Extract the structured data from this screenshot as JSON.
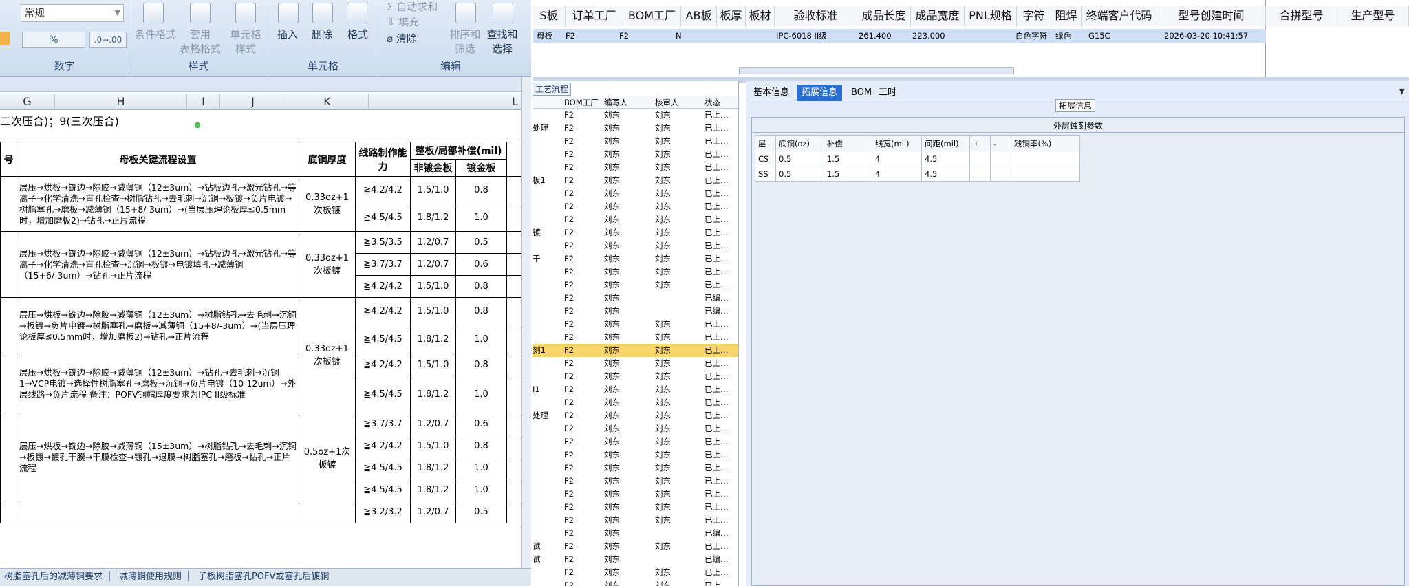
{
  "ribbon": {
    "number_format": "常规",
    "autosum": "自动求和",
    "fill": "填充",
    "clear": "清除",
    "cond_format": "条件格式",
    "table_format_1": "套用",
    "table_format_2": "表格格式",
    "cell_style_1": "单元格",
    "cell_style_2": "样式",
    "insert": "插入",
    "delete": "删除",
    "format": "格式",
    "sort_1": "排序和",
    "sort_2": "筛选",
    "find_1": "查找和",
    "find_2": "选择",
    "group_number": "数字",
    "group_style": "样式",
    "group_cells": "单元格",
    "group_edit": "编辑",
    "percent": "%"
  },
  "sheet": {
    "columns": [
      "G",
      "H",
      "I",
      "J",
      "K",
      "L"
    ],
    "top_note": "二次压合)；9(三次压合)",
    "headers": {
      "h_key": "母板关键流程设置",
      "h_cu": "底铜厚度",
      "h_cap": "线路制作能力",
      "h_comp": "整板/局部补偿(mil)",
      "h_nonplate": "非镀金板",
      "h_plate": "镀金板",
      "h_prefix": "号"
    },
    "blocks": [
      {
        "process": "层压→烘板→铣边→除胶→减薄铜（12±3um）→钻板边孔→激光钻孔→等离子→化学清洗→盲孔检查→树脂钻孔→去毛刺→沉铜→板镀→负片电镀→树脂塞孔→磨板→减薄铜（15+8/-3um）→(当层压理论板厚≦0.5mm时，增加磨板2)→钻孔→正片流程",
        "cu": "0.33oz+1次板镀",
        "rows": [
          [
            "≧4.2/4.2",
            "1.5/1.0",
            "0.8"
          ],
          [
            "≧4.5/4.5",
            "1.8/1.2",
            "1.0"
          ]
        ]
      },
      {
        "process": "层压→烘板→铣边→除胶→减薄铜（12±3um）→钻板边孔→激光钻孔→等离子→化学清洗→盲孔检查→沉铜→板镀→电镀填孔→减薄铜（15+6/-3um）→钻孔→正片流程",
        "cu": "0.33oz+1次板镀",
        "rows": [
          [
            "≧3.5/3.5",
            "1.2/0.7",
            "0.5"
          ],
          [
            "≧3.7/3.7",
            "1.2/0.7",
            "0.6"
          ],
          [
            "≧4.2/4.2",
            "1.5/1.0",
            "0.8"
          ]
        ]
      },
      {
        "process": "层压→烘板→铣边→除胶→减薄铜（12±3um）→树脂钻孔→去毛刺→沉铜→板镀→负片电镀→树脂塞孔→磨板→减薄铜（15+8/-3um）→(当层压理论板厚≦0.5mm时，增加磨板2)→钻孔→正片流程",
        "cu": "0.33oz+1次板镀",
        "rows": [
          [
            "≧4.2/4.2",
            "1.5/1.0",
            "0.8"
          ],
          [
            "≧4.5/4.5",
            "1.8/1.2",
            "1.0"
          ],
          [
            "≧4.2/4.2",
            "1.5/1.0",
            "0.8"
          ]
        ]
      },
      {
        "process": "层压→烘板→铣边→除胶→减薄铜（12±3um）→钻孔→去毛刺→沉铜1→VCP电镀→选择性树脂塞孔→磨板→沉铜→负片电镀（10-12um）→外层线路→负片流程 备注：POFV铜帽厚度要求为IPC II级标准",
        "rows": [
          [
            "≧4.5/4.5",
            "1.8/1.2",
            "1.0"
          ]
        ]
      },
      {
        "process": "层压→烘板→铣边→除胶→减薄铜（15±3um）→树脂钻孔→去毛刺→沉铜→板镀→镀孔干膜→干膜检查→镀孔→退膜→树脂塞孔→磨板→钻孔→正片流程",
        "cu": "0.5oz+1次板镀",
        "rows": [
          [
            "≧3.7/3.7",
            "1.2/0.7",
            "0.6"
          ],
          [
            "≧4.2/4.2",
            "1.5/1.0",
            "0.8"
          ],
          [
            "≧4.5/4.5",
            "1.8/1.2",
            "1.0"
          ],
          [
            "≧4.5/4.5",
            "1.8/1.2",
            "1.0"
          ]
        ]
      },
      {
        "process": "",
        "rows": [
          [
            "≧3.2/3.2",
            "1.2/0.7",
            "0.5"
          ]
        ]
      }
    ],
    "tabs": [
      "树脂塞孔后的减薄铜要求",
      "减薄铜使用规则",
      "子板树脂塞孔POFV或塞孔后镀铜"
    ]
  },
  "top_grid": {
    "headers": [
      "S板",
      "订单工厂",
      "BOM工厂",
      "AB板",
      "板厚",
      "板材",
      "验收标准",
      "成品长度",
      "成品宽度",
      "PNL规格",
      "字符",
      "阻焊",
      "终端客户代码",
      "型号创建时间"
    ],
    "row": {
      "c1": "母板",
      "c2": "F2",
      "c3": "F2",
      "c4": "N",
      "c5": "IPC-6018 II级",
      "c6": "261.400",
      "c7": "223.000",
      "c8": "白色字符",
      "c9": "绿色",
      "c10": "G15C",
      "c11": "2026-03-20 10:41:57"
    },
    "right_headers": [
      "合拼型号",
      "生产型号"
    ]
  },
  "process_list": {
    "title": "工艺流程",
    "headers": [
      "BOM工厂",
      "编写人",
      "核审人",
      "状态"
    ],
    "rows": [
      [
        "",
        "F2",
        "刘东",
        "刘东",
        "已上…"
      ],
      [
        "处理",
        "F2",
        "刘东",
        "刘东",
        "已上…"
      ],
      [
        "",
        "F2",
        "刘东",
        "刘东",
        "已上…"
      ],
      [
        "",
        "F2",
        "刘东",
        "刘东",
        "已上…"
      ],
      [
        "",
        "F2",
        "刘东",
        "刘东",
        "已上…"
      ],
      [
        "板1",
        "F2",
        "刘东",
        "刘东",
        "已上…"
      ],
      [
        "",
        "F2",
        "刘东",
        "刘东",
        "已上…"
      ],
      [
        "",
        "F2",
        "刘东",
        "刘东",
        "已上…"
      ],
      [
        "",
        "F2",
        "刘东",
        "刘东",
        "已上…"
      ],
      [
        "镀",
        "F2",
        "刘东",
        "刘东",
        "已上…"
      ],
      [
        "",
        "F2",
        "刘东",
        "刘东",
        "已上…"
      ],
      [
        "干",
        "F2",
        "刘东",
        "刘东",
        "已上…"
      ],
      [
        "",
        "F2",
        "刘东",
        "刘东",
        "已上…"
      ],
      [
        "",
        "F2",
        "刘东",
        "刘东",
        "已上…"
      ],
      [
        "",
        "F2",
        "刘东",
        "",
        "已编…"
      ],
      [
        "",
        "F2",
        "刘东",
        "",
        "已编…"
      ],
      [
        "",
        "F2",
        "刘东",
        "刘东",
        "已上…"
      ],
      [
        "",
        "F2",
        "刘东",
        "刘东",
        "已上…"
      ],
      [
        "刻1",
        "F2",
        "刘东",
        "刘东",
        "已上…"
      ],
      [
        "",
        "F2",
        "刘东",
        "刘东",
        "已上…"
      ],
      [
        "",
        "F2",
        "刘东",
        "刘东",
        "已上…"
      ],
      [
        "I1",
        "F2",
        "刘东",
        "刘东",
        "已上…"
      ],
      [
        "",
        "F2",
        "刘东",
        "刘东",
        "已上…"
      ],
      [
        "处理",
        "F2",
        "刘东",
        "刘东",
        "已上…"
      ],
      [
        "",
        "F2",
        "刘东",
        "刘东",
        "已上…"
      ],
      [
        "",
        "F2",
        "刘东",
        "刘东",
        "已上…"
      ],
      [
        "",
        "F2",
        "刘东",
        "刘东",
        "已上…"
      ],
      [
        "",
        "F2",
        "刘东",
        "刘东",
        "已上…"
      ],
      [
        "",
        "F2",
        "刘东",
        "刘东",
        "已上…"
      ],
      [
        "",
        "F2",
        "刘东",
        "刘东",
        "已上…"
      ],
      [
        "",
        "F2",
        "刘东",
        "刘东",
        "已上…"
      ],
      [
        "",
        "F2",
        "刘东",
        "刘东",
        "已上…"
      ],
      [
        "",
        "F2",
        "刘东",
        "",
        "已编…"
      ],
      [
        "试",
        "F2",
        "刘东",
        "刘东",
        "已上…"
      ],
      [
        "试",
        "F2",
        "刘东",
        "",
        "已编…"
      ],
      [
        "",
        "F2",
        "刘东",
        "刘东",
        "已上…"
      ],
      [
        "",
        "F2",
        "刘东",
        "刘东",
        "已上…"
      ]
    ]
  },
  "right_panel": {
    "tabs": [
      "基本信息",
      "拓展信息",
      "BOM",
      "工时"
    ],
    "section": "拓展信息",
    "table_title": "外层蚀刻参数",
    "headers": [
      "层",
      "底铜(oz)",
      "补偿",
      "线宽(mil)",
      "间距(mil)",
      "+",
      "-",
      "残铜率(%)"
    ],
    "rows": [
      [
        "CS",
        "0.5",
        "1.5",
        "4",
        "4.5",
        "",
        "",
        ""
      ],
      [
        "SS",
        "0.5",
        "1.5",
        "4",
        "4.5",
        "",
        "",
        ""
      ]
    ]
  },
  "colors": {
    "accent": "#2a6fd0",
    "highlight": "#f9d66b",
    "ribbon": "#dbe6f3"
  }
}
